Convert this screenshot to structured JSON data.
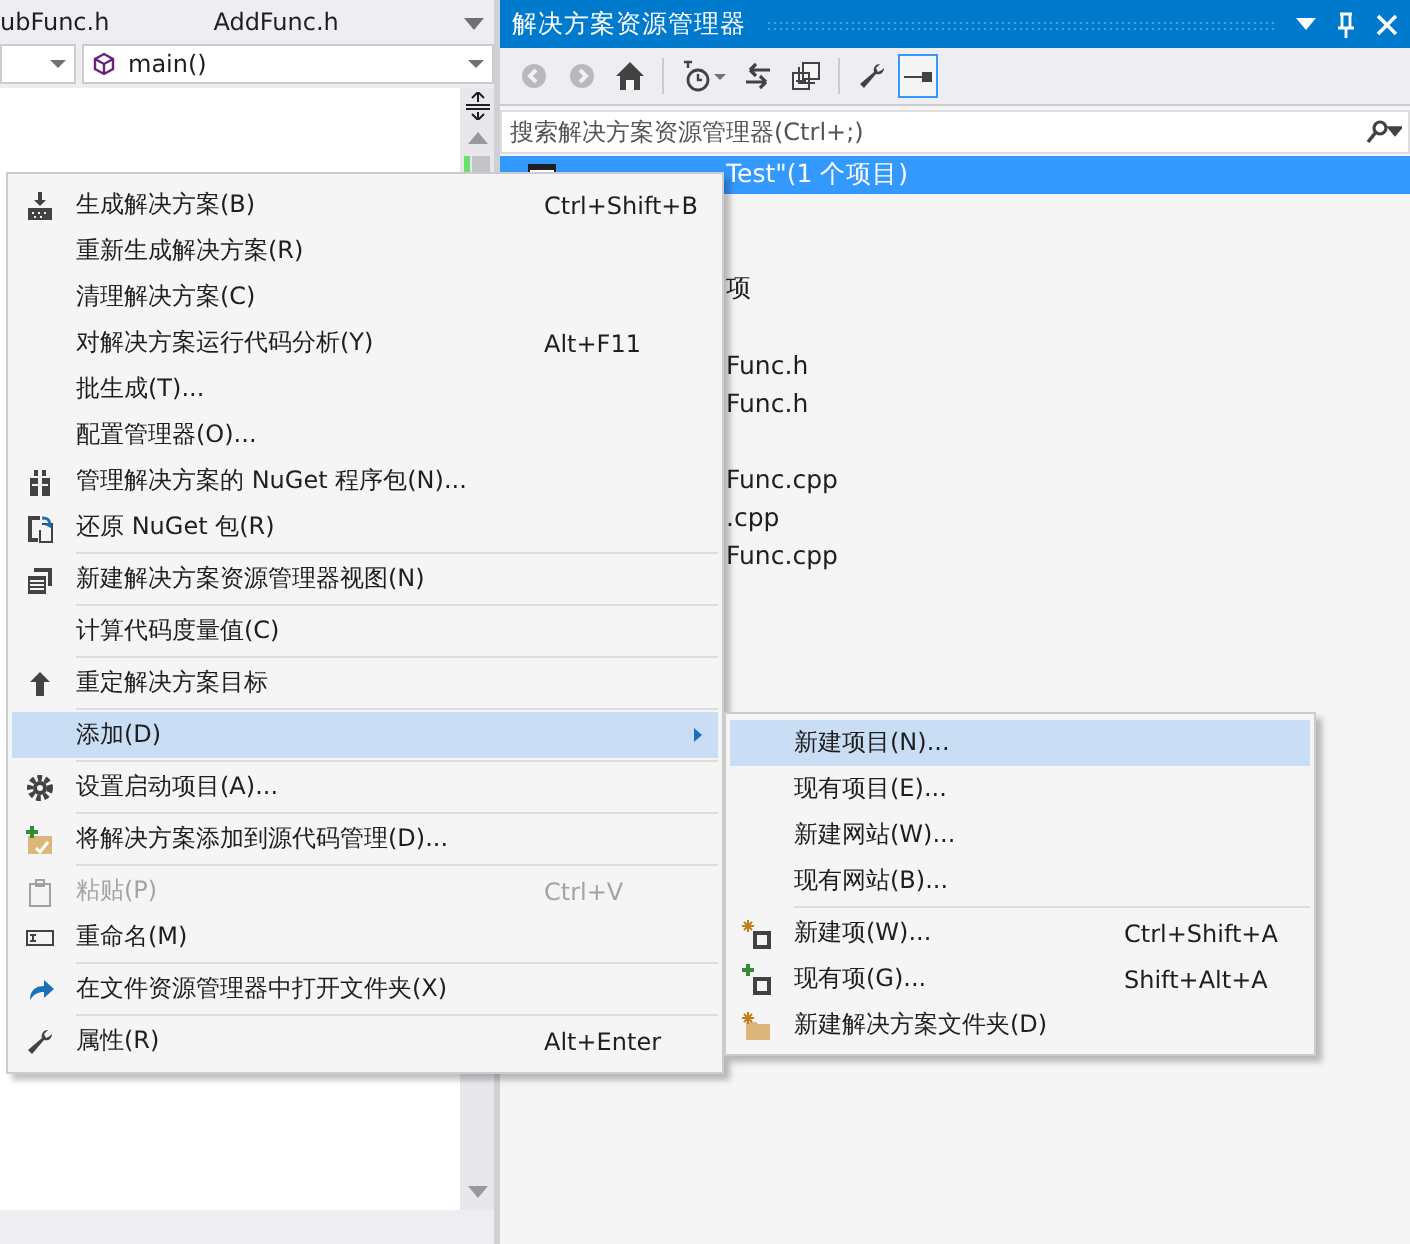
{
  "editor": {
    "tabs": [
      {
        "label": "ubFunc.h",
        "selected": false
      },
      {
        "label": "AddFunc.h",
        "selected": false
      }
    ],
    "member_combo": {
      "value": "main()"
    }
  },
  "solution_explorer": {
    "title": "解决方案资源管理器",
    "toolbar": [
      {
        "disabled": true,
        "selected": false
      },
      {
        "disabled": true,
        "selected": false
      },
      {
        "disabled": false,
        "selected": false
      },
      {
        "disabled": false,
        "selected": false
      },
      {
        "disabled": false,
        "selected": false
      },
      {
        "disabled": false,
        "selected": false
      },
      {
        "disabled": false,
        "selected": false
      },
      {
        "disabled": false,
        "selected": true
      }
    ],
    "search": {
      "placeholder": "搜索解决方案资源管理器(Ctrl+;)"
    },
    "tree": [
      {
        "label": "Test\"(1 个项目)",
        "selected": true
      },
      {
        "selected": false
      },
      {
        "selected": false
      },
      {
        "label": "项",
        "selected": false
      },
      {
        "selected": false
      },
      {
        "label": "Func.h",
        "selected": false
      },
      {
        "label": "Func.h",
        "selected": false
      },
      {
        "selected": false
      },
      {
        "label": "Func.cpp",
        "selected": false
      },
      {
        "label": ".cpp",
        "selected": false
      },
      {
        "label": "Func.cpp",
        "selected": false
      }
    ]
  },
  "context_menu": {
    "items": [
      {
        "kind": "item",
        "label": "生成解决方案(B)",
        "shortcut": "Ctrl+Shift+B",
        "selected": false,
        "disabled": false,
        "has_submenu": false
      },
      {
        "kind": "item",
        "label": "重新生成解决方案(R)",
        "selected": false,
        "disabled": false,
        "has_submenu": false
      },
      {
        "kind": "item",
        "label": "清理解决方案(C)",
        "selected": false,
        "disabled": false,
        "has_submenu": false
      },
      {
        "kind": "item",
        "label": "对解决方案运行代码分析(Y)",
        "shortcut": "Alt+F11",
        "selected": false,
        "disabled": false,
        "has_submenu": false
      },
      {
        "kind": "item",
        "label": "批生成(T)...",
        "selected": false,
        "disabled": false,
        "has_submenu": false
      },
      {
        "kind": "item",
        "label": "配置管理器(O)...",
        "selected": false,
        "disabled": false,
        "has_submenu": false
      },
      {
        "kind": "item",
        "label": "管理解决方案的 NuGet 程序包(N)...",
        "selected": false,
        "disabled": false,
        "has_submenu": false
      },
      {
        "kind": "item",
        "label": "还原 NuGet 包(R)",
        "selected": false,
        "disabled": false,
        "has_submenu": false
      },
      {
        "kind": "separator"
      },
      {
        "kind": "item",
        "label": "新建解决方案资源管理器视图(N)",
        "selected": false,
        "disabled": false,
        "has_submenu": false
      },
      {
        "kind": "separator"
      },
      {
        "kind": "item",
        "label": "计算代码度量值(C)",
        "selected": false,
        "disabled": false,
        "has_submenu": false
      },
      {
        "kind": "separator"
      },
      {
        "kind": "item",
        "label": "重定解决方案目标",
        "selected": false,
        "disabled": false,
        "has_submenu": false
      },
      {
        "kind": "separator"
      },
      {
        "kind": "item",
        "label": "添加(D)",
        "selected": true,
        "disabled": false,
        "has_submenu": true
      },
      {
        "kind": "separator"
      },
      {
        "kind": "item",
        "label": "设置启动项目(A)...",
        "selected": false,
        "disabled": false,
        "has_submenu": false
      },
      {
        "kind": "separator"
      },
      {
        "kind": "item",
        "label": "将解决方案添加到源代码管理(D)...",
        "selected": false,
        "disabled": false,
        "has_submenu": false
      },
      {
        "kind": "separator"
      },
      {
        "kind": "item",
        "label": "粘贴(P)",
        "shortcut": "Ctrl+V",
        "selected": false,
        "disabled": true,
        "has_submenu": false
      },
      {
        "kind": "item",
        "label": "重命名(M)",
        "selected": false,
        "disabled": false,
        "has_submenu": false
      },
      {
        "kind": "separator"
      },
      {
        "kind": "item",
        "label": "在文件资源管理器中打开文件夹(X)",
        "selected": false,
        "disabled": false,
        "has_submenu": false
      },
      {
        "kind": "separator"
      },
      {
        "kind": "item",
        "label": "属性(R)",
        "shortcut": "Alt+Enter",
        "selected": false,
        "disabled": false,
        "has_submenu": false
      }
    ]
  },
  "submenu": {
    "items": [
      {
        "kind": "item",
        "label": "新建项目(N)...",
        "selected": true
      },
      {
        "kind": "item",
        "label": "现有项目(E)...",
        "selected": false
      },
      {
        "kind": "item",
        "label": "新建网站(W)...",
        "selected": false
      },
      {
        "kind": "item",
        "label": "现有网站(B)...",
        "selected": false
      },
      {
        "kind": "separator"
      },
      {
        "kind": "item",
        "label": "新建项(W)...",
        "shortcut": "Ctrl+Shift+A",
        "selected": false
      },
      {
        "kind": "item",
        "label": "现有项(G)...",
        "shortcut": "Shift+Alt+A",
        "selected": false
      },
      {
        "kind": "item",
        "label": "新建解决方案文件夹(D)",
        "selected": false
      }
    ]
  }
}
